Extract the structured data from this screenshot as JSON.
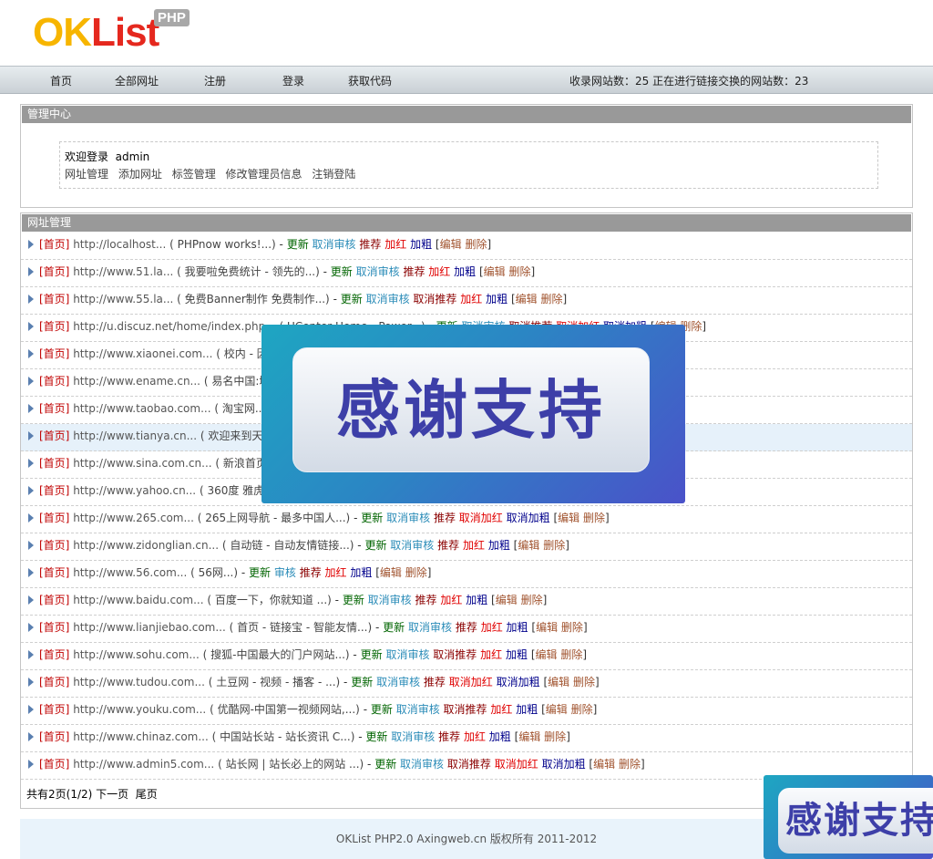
{
  "logo": {
    "part_ok": "OK",
    "part_list": "List",
    "badge": "PHP"
  },
  "nav": {
    "items": [
      "首页",
      "全部网址",
      "注册",
      "登录",
      "获取代码"
    ],
    "stats": "收录网站数：25 正在进行链接交换的网站数：23"
  },
  "admin": {
    "title": "管理中心",
    "welcome_prefix": "欢迎登录",
    "username": "admin",
    "links": [
      "网址管理",
      "添加网址",
      "标签管理",
      "修改管理员信息",
      "注销登陆"
    ]
  },
  "urls": {
    "title": "网址管理",
    "rows": [
      {
        "home": "[首页]",
        "url": "http://localhost...",
        "desc": "( PHPnow works!...)",
        "actions": [
          "更新",
          "取消审核",
          "推荐",
          "加红",
          "加粗"
        ]
      },
      {
        "home": "[首页]",
        "url": "http://www.51.la...",
        "desc": "( 我要啦免费统计 - 领先的...)",
        "actions": [
          "更新",
          "取消审核",
          "推荐",
          "加红",
          "加粗"
        ]
      },
      {
        "home": "[首页]",
        "url": "http://www.55.la...",
        "desc": "( 免费Banner制作 免费制作...)",
        "actions": [
          "更新",
          "取消审核",
          "取消推荐",
          "加红",
          "加粗"
        ]
      },
      {
        "home": "[首页]",
        "url": "http://u.discuz.net/home/index.php...",
        "desc": "( UCenter Home - Power...)",
        "actions": [
          "更新",
          "取消审核",
          "取消推荐",
          "取消加红",
          "取消加粗"
        ]
      },
      {
        "home": "[首页]",
        "url": "http://www.xiaonei.com...",
        "desc": "( 校内 - 因...)",
        "actions": []
      },
      {
        "home": "[首页]",
        "url": "http://www.ename.cn...",
        "desc": "( 易名中国:域...)",
        "actions": []
      },
      {
        "home": "[首页]",
        "url": "http://www.taobao.com...",
        "desc": "( 淘宝网...)",
        "actions": []
      },
      {
        "home": "[首页]",
        "url": "http://www.tianya.cn...",
        "desc": "( 欢迎来到天...)",
        "actions": []
      },
      {
        "home": "[首页]",
        "url": "http://www.sina.com.cn...",
        "desc": "( 新浪首页...)",
        "actions": []
      },
      {
        "home": "[首页]",
        "url": "http://www.yahoo.cn...",
        "desc": "( 360度 雅虎...)",
        "actions": []
      },
      {
        "home": "[首页]",
        "url": "http://www.265.com...",
        "desc": "( 265上网导航 - 最多中国人...)",
        "actions": [
          "更新",
          "取消审核",
          "推荐",
          "取消加红",
          "取消加粗"
        ]
      },
      {
        "home": "[首页]",
        "url": "http://www.zidonglian.cn...",
        "desc": "( 自动链 - 自动友情链接...)",
        "actions": [
          "更新",
          "取消审核",
          "推荐",
          "加红",
          "加粗"
        ]
      },
      {
        "home": "[首页]",
        "url": "http://www.56.com...",
        "desc": "( 56网...)",
        "actions": [
          "更新",
          "审核",
          "推荐",
          "加红",
          "加粗"
        ]
      },
      {
        "home": "[首页]",
        "url": "http://www.baidu.com...",
        "desc": "( 百度一下，你就知道 ...)",
        "actions": [
          "更新",
          "取消审核",
          "推荐",
          "加红",
          "加粗"
        ]
      },
      {
        "home": "[首页]",
        "url": "http://www.lianjiebao.com...",
        "desc": "( 首页 - 链接宝 - 智能友情...)",
        "actions": [
          "更新",
          "取消审核",
          "推荐",
          "加红",
          "加粗"
        ]
      },
      {
        "home": "[首页]",
        "url": "http://www.sohu.com...",
        "desc": "( 搜狐-中国最大的门户网站...)",
        "actions": [
          "更新",
          "取消审核",
          "取消推荐",
          "加红",
          "加粗"
        ]
      },
      {
        "home": "[首页]",
        "url": "http://www.tudou.com...",
        "desc": "( 土豆网 - 视频 - 播客 - ...)",
        "actions": [
          "更新",
          "取消审核",
          "推荐",
          "取消加红",
          "取消加粗"
        ]
      },
      {
        "home": "[首页]",
        "url": "http://www.youku.com...",
        "desc": "( 优酷网-中国第一视频网站,...)",
        "actions": [
          "更新",
          "取消审核",
          "取消推荐",
          "加红",
          "加粗"
        ]
      },
      {
        "home": "[首页]",
        "url": "http://www.chinaz.com...",
        "desc": "( 中国站长站 - 站长资讯 C...)",
        "actions": [
          "更新",
          "取消审核",
          "推荐",
          "加红",
          "加粗"
        ]
      },
      {
        "home": "[首页]",
        "url": "http://www.admin5.com...",
        "desc": "( 站长网 | 站长必上的网站 ...)",
        "actions": [
          "更新",
          "取消审核",
          "取消推荐",
          "取消加红",
          "取消加粗"
        ]
      }
    ],
    "edit_label": "编辑",
    "delete_label": "删除",
    "bracket_open": "[",
    "bracket_close": "]",
    "separator": "-"
  },
  "pager": {
    "info": "共有2页(1/2)",
    "next": "下一页",
    "last": "尾页"
  },
  "footer": {
    "text": "OKList PHP2.0 Axingweb.cn 版权所有  2011-2012"
  },
  "overlay": {
    "text": "感谢支持"
  },
  "colors": {
    "title_bar": "#999999",
    "nav_bg": "#d5dbe0",
    "home_link": "#c00000",
    "footer_bg": "#e9f3fb"
  }
}
